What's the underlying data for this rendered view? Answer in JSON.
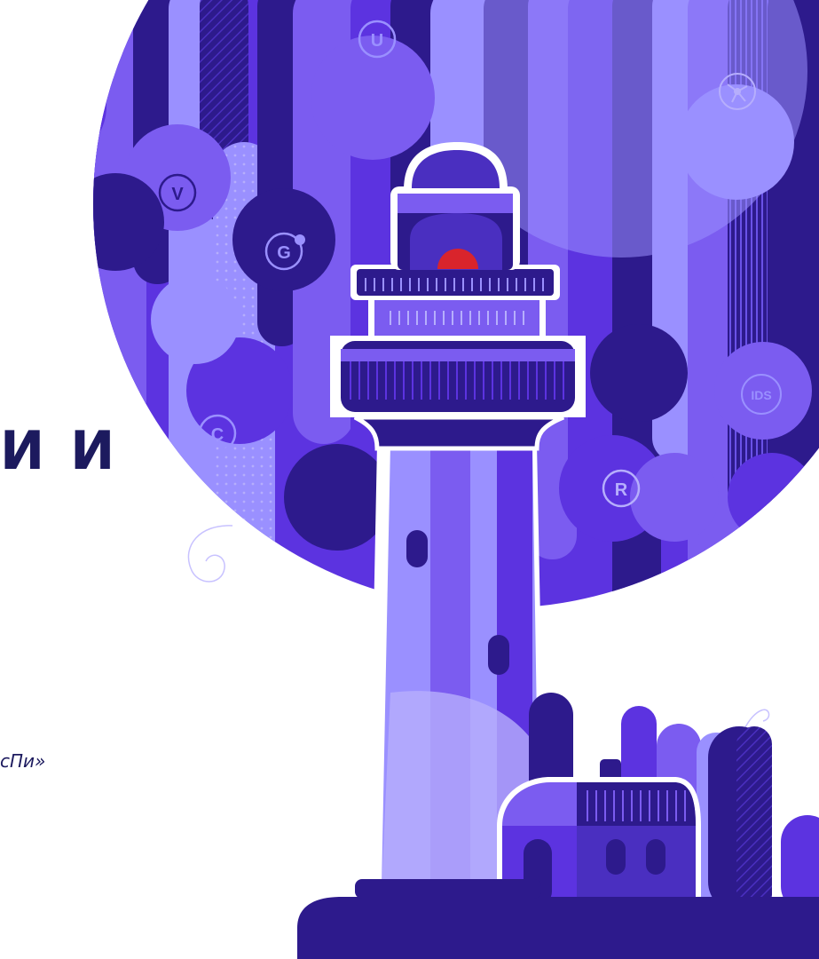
{
  "heading_fragment": "И И",
  "quote_fragment": "сПи»",
  "badges": [
    {
      "label": "U",
      "icon": "letter-u-badge"
    },
    {
      "label": "V",
      "icon": "letter-v-badge"
    },
    {
      "label": "G",
      "icon": "letter-g-badge"
    },
    {
      "label": "C",
      "icon": "letter-c-badge"
    },
    {
      "label": "R",
      "icon": "letter-r-badge"
    },
    {
      "label": "IDS",
      "icon": "ids-badge"
    }
  ],
  "colors": {
    "navy": "#1c1a5e",
    "deep_purple": "#2d1a8c",
    "purple": "#5c33e0",
    "violet": "#7b5cf0",
    "lavender": "#9a90ff",
    "pale_lavender": "#b6aefc",
    "beacon_red": "#d9242c",
    "white": "#ffffff"
  }
}
